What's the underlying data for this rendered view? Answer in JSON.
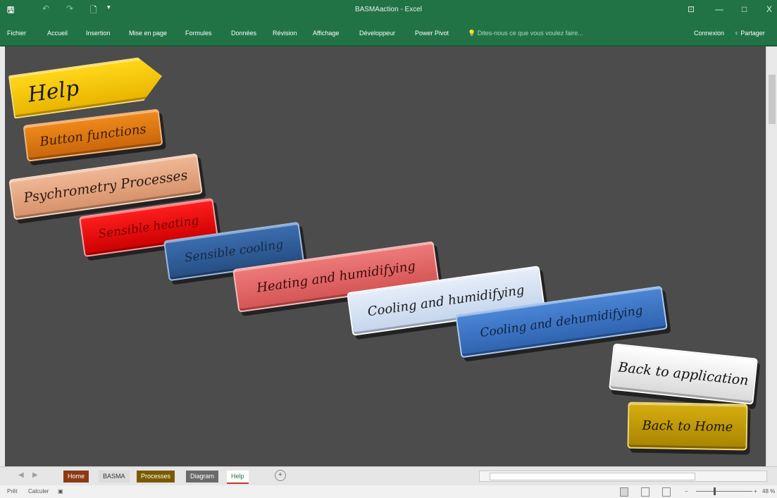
{
  "titlebar": {
    "doc_title": "BASMAaction - Excel",
    "save_icon": "save-icon",
    "undo_icon": "undo-icon",
    "redo_icon": "redo-icon",
    "new_icon": "new-document-icon",
    "minimize": "—",
    "restore": "□",
    "close": "X",
    "ribbon_display": "⊡"
  },
  "ribbon": {
    "tabs": [
      "Fichier",
      "Accueil",
      "Insertion",
      "Mise en page",
      "Formules",
      "Données",
      "Révision",
      "Affichage",
      "Développeur",
      "Power Pivot"
    ],
    "tell_me": "Dites-nous ce que vous voulez faire...",
    "signin": "Connexion",
    "share": "Partager"
  },
  "sheet_buttons": {
    "help": "Help",
    "button_functions": "Button functions",
    "psychrometry": "Psychrometry Processes",
    "sensible_heating": "Sensible heating",
    "sensible_cooling": "Sensible cooling",
    "heating_humidifying": "Heating and humidifying",
    "cooling_humidifying": "Cooling and humidifying",
    "cooling_dehumidifying": "Cooling and dehumidifying",
    "back_application": "Back to application",
    "back_home": "Back to Home"
  },
  "sheet_tabs": {
    "home": "Home",
    "basma": "BASMA",
    "processes": "Processes",
    "diagram": "Diagram",
    "help": "Help"
  },
  "statusbar": {
    "ready": "Prêt",
    "calculate": "Calculer",
    "zoom": "48 %"
  },
  "colors": {
    "accent": "#217346",
    "help": "#f5c400",
    "button_functions": "#e07a12",
    "psychrometry": "#e7a77e",
    "sensible_heating": "#e01010",
    "sensible_cooling": "#2e5c98",
    "heating_humidifying": "#e06565",
    "cooling_humidifying": "#d4e2f4",
    "cooling_dehumidifying": "#3d74c4",
    "back_application": "#eaeaea",
    "back_home": "#c8a000"
  }
}
